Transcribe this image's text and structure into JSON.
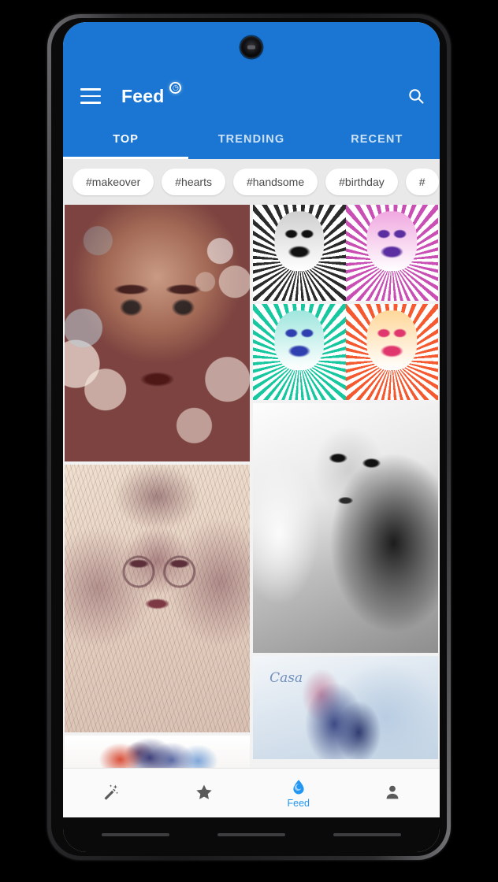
{
  "app": {
    "title": "Feed",
    "title_badge_icon": "clock-badge-icon",
    "menu_icon": "hamburger-menu-icon",
    "search_icon": "search-icon",
    "accent_color": "#1a76d2",
    "active_nav_color": "#2196f3"
  },
  "tabs": [
    {
      "label": "TOP",
      "active": true
    },
    {
      "label": "TRENDING",
      "active": false
    },
    {
      "label": "RECENT",
      "active": false
    }
  ],
  "chips": [
    {
      "label": "#makeover"
    },
    {
      "label": "#hearts"
    },
    {
      "label": "#handsome"
    },
    {
      "label": "#birthday"
    },
    {
      "label": "#"
    }
  ],
  "feed": {
    "left_column": [
      {
        "name": "bokeh-portrait-tile",
        "caption": ""
      },
      {
        "name": "sepia-sketch-portrait-tile",
        "caption": ""
      },
      {
        "name": "color-splash-tile",
        "caption": ""
      }
    ],
    "right_column": [
      {
        "name": "popart-quad-tile-1",
        "caption": ""
      },
      {
        "name": "popart-quad-tile-2",
        "caption": ""
      },
      {
        "name": "blackwhite-portrait-tile",
        "caption": ""
      },
      {
        "name": "watercolor-camera-girl-tile",
        "caption": "Casa"
      }
    ]
  },
  "bottom_nav": [
    {
      "label": "",
      "icon": "magic-wand-icon",
      "active": false
    },
    {
      "label": "",
      "icon": "star-icon",
      "active": false
    },
    {
      "label": "Feed",
      "icon": "water-drop-icon",
      "active": true
    },
    {
      "label": "",
      "icon": "person-icon",
      "active": false
    }
  ]
}
